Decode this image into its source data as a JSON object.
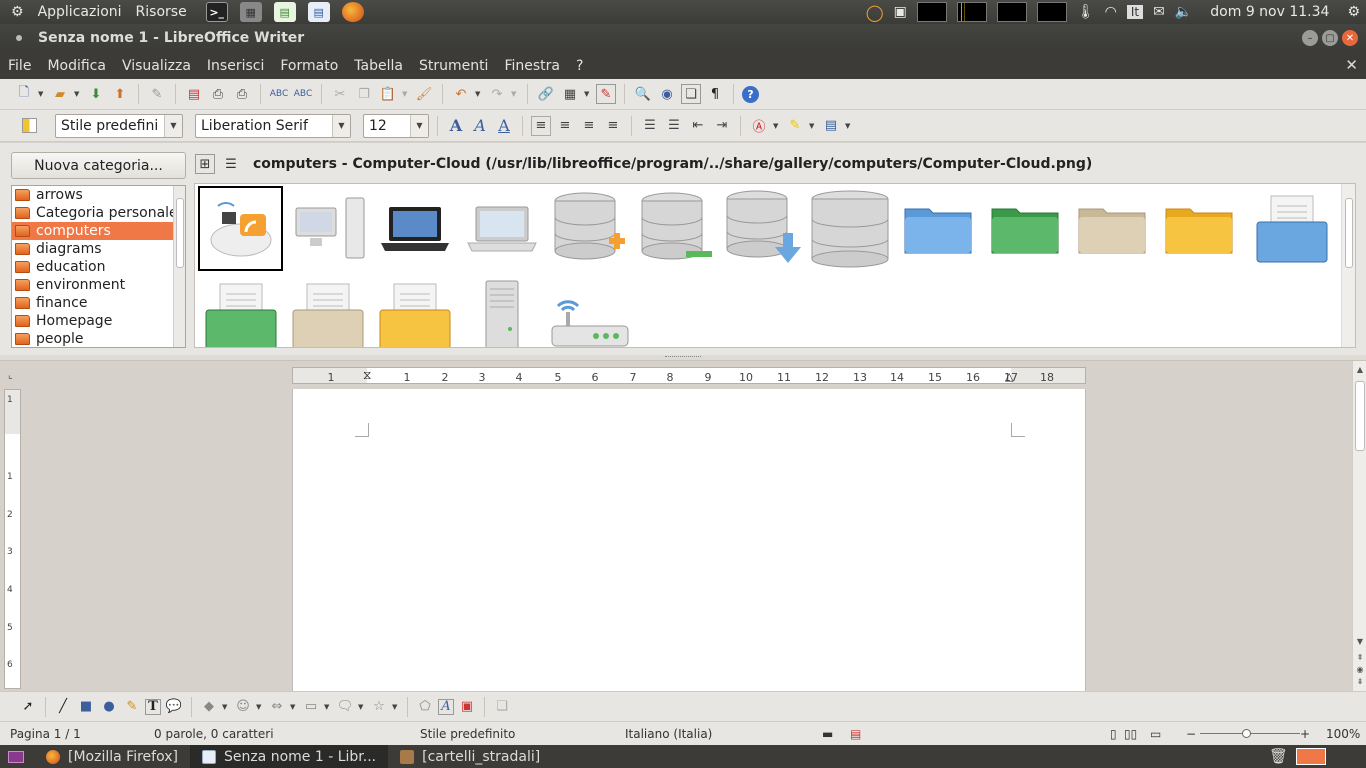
{
  "top_panel": {
    "menu_applications": "Applicazioni",
    "menu_places": "Risorse",
    "clock": "dom  9 nov 11.34",
    "keyboard_layout": "It"
  },
  "window": {
    "title": "Senza nome 1 - LibreOffice Writer"
  },
  "menubar": {
    "items": [
      "File",
      "Modifica",
      "Visualizza",
      "Inserisci",
      "Formato",
      "Tabella",
      "Strumenti",
      "Finestra",
      "?"
    ],
    "close_symbol": "✕"
  },
  "format_toolbar": {
    "paragraph_style": "Stile predefini",
    "font_name": "Liberation Serif",
    "font_size": "12"
  },
  "gallery": {
    "new_category_label": "Nuova categoria...",
    "categories": [
      {
        "label": "arrows"
      },
      {
        "label": "Categoria personale"
      },
      {
        "label": "computers"
      },
      {
        "label": "diagrams"
      },
      {
        "label": "education"
      },
      {
        "label": "environment"
      },
      {
        "label": "finance"
      },
      {
        "label": "Homepage"
      },
      {
        "label": "people"
      }
    ],
    "selected_category": "computers",
    "path_label": "computers - Computer-Cloud (/usr/lib/libreoffice/program/../share/gallery/computers/Computer-Cloud.png)"
  },
  "ruler": {
    "h_ticks": [
      "1",
      "1",
      "2",
      "3",
      "4",
      "5",
      "6",
      "7",
      "8",
      "9",
      "10",
      "11",
      "12",
      "13",
      "14",
      "15",
      "16",
      "17",
      "18"
    ],
    "v_ticks": [
      "1",
      "1",
      "2",
      "3",
      "4",
      "5",
      "6"
    ]
  },
  "statusbar": {
    "page": "Pagina 1 / 1",
    "words": "0 parole, 0 caratteri",
    "style": "Stile predefinito",
    "language": "Italiano (Italia)",
    "zoom": "100%"
  },
  "taskbar": {
    "items": [
      {
        "label": "[Mozilla Firefox]"
      },
      {
        "label": "Senza nome 1 - Libr..."
      },
      {
        "label": "[cartelli_stradali]"
      }
    ]
  },
  "colors": {
    "selection": "#f07746",
    "panel_dark": "#3c3b37",
    "toolbar_bg": "#e8e6e2",
    "close_button": "#e9683b"
  }
}
